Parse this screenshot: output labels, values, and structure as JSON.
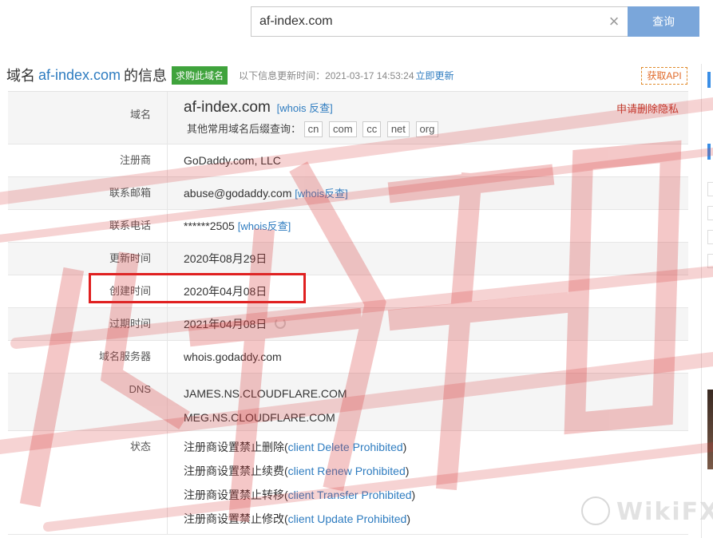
{
  "search": {
    "value": "af-index.com",
    "clear_icon": "close-icon",
    "button_label": "查询"
  },
  "header": {
    "prefix": "域名",
    "domain": "af-index.com",
    "suffix": "的信息",
    "buy_label": "求购此域名",
    "update_note": "以下信息更新时间：2021-03-17 14:53:24",
    "update_link": "立即更新",
    "api_label": "获取API"
  },
  "rows": {
    "domain": {
      "label": "域名",
      "value": "af-index.com",
      "whois_link": "[whois 反查]",
      "delete_privacy": "申请删除隐私",
      "other_suffix_label": "其他常用域名后缀查询：",
      "suffixes": [
        "cn",
        "com",
        "cc",
        "net",
        "org"
      ]
    },
    "registrar": {
      "label": "注册商",
      "value": "GoDaddy.com, LLC"
    },
    "email": {
      "label": "联系邮箱",
      "value": "abuse@godaddy.com",
      "link": "[whois反查]"
    },
    "phone": {
      "label": "联系电话",
      "value": "******2505",
      "link": "[whois反查]"
    },
    "updated": {
      "label": "更新时间",
      "value": "2020年08月29日"
    },
    "created": {
      "label": "创建时间",
      "value": "2020年04月08日"
    },
    "expires": {
      "label": "过期时间",
      "value": "2021年04月08日"
    },
    "whois_server": {
      "label": "域名服务器",
      "value": "whois.godaddy.com"
    },
    "dns": {
      "label": "DNS",
      "values": [
        "JAMES.NS.CLOUDFLARE.COM",
        "MEG.NS.CLOUDFLARE.COM"
      ]
    },
    "status": {
      "label": "状态",
      "items": [
        {
          "prefix": "注册商设置禁止删除(",
          "code": "client Delete Prohibited",
          "suffix": ")"
        },
        {
          "prefix": "注册商设置禁止续费(",
          "code": "client Renew Prohibited",
          "suffix": ")"
        },
        {
          "prefix": "注册商设置禁止转移(",
          "code": "client Transfer Prohibited",
          "suffix": ")"
        },
        {
          "prefix": "注册商设置禁止修改(",
          "code": "client Update Prohibited",
          "suffix": ")"
        }
      ]
    }
  },
  "watermark": {
    "brand": "WikiFX",
    "stamp_text": "外汇天眼",
    "stamp_color": "#d83a3a"
  },
  "colors": {
    "link": "#2e7cc0",
    "accent_green": "#3fa33c",
    "search_button": "#7aa6da",
    "highlight_box": "#e02020"
  }
}
